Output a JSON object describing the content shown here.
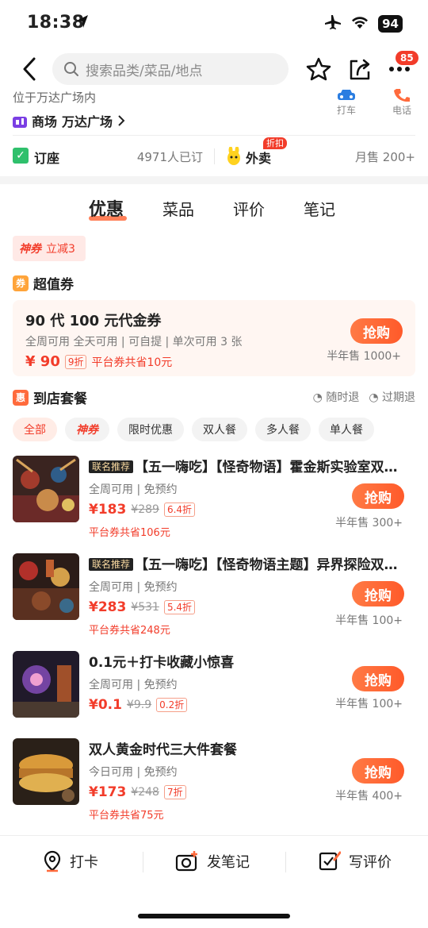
{
  "status": {
    "time": "18:38",
    "battery": "94"
  },
  "nav": {
    "search_placeholder": "搜索品类/菜品/地点",
    "more_badge": "85"
  },
  "shop": {
    "address": "位于万达广场内",
    "mall_label": "商场",
    "mall_name": "万达广场",
    "quick_car": "打车",
    "quick_phone": "电话"
  },
  "booking": {
    "label": "订座",
    "count": "4971人已订",
    "takeout_label": "外卖",
    "takeout_badge": "折扣",
    "monthly_sales": "月售 200+"
  },
  "tabs": [
    "优惠",
    "菜品",
    "评价",
    "笔记"
  ],
  "promo": {
    "logo": "神券",
    "text": "立减3"
  },
  "voucher_section": {
    "icon": "券",
    "title": "超值券",
    "voucher_title": "90 代 100 元代金券",
    "tags": "全周可用 全天可用 | 可自提 | 单次可用 3 张",
    "price": "¥ 90",
    "discount": "9折",
    "save": "平台券共省10元",
    "buy": "抢购",
    "sold": "半年售 1000+"
  },
  "deal_section": {
    "icon": "惠",
    "title": "到店套餐",
    "refund1": "随时退",
    "refund2": "过期退",
    "chips": [
      "全部",
      "神券",
      "限时优惠",
      "双人餐",
      "多人餐",
      "单人餐"
    ]
  },
  "deals": [
    {
      "tag": "联名推荐",
      "title": "【五一嗨吃】【怪奇物语】霍金斯实验室双人套餐",
      "sub": "全周可用 | 免预约",
      "price": "¥183",
      "orig": "¥289",
      "disc": "6.4折",
      "save": "平台券共省106元",
      "buy": "抢购",
      "sold": "半年售 300+"
    },
    {
      "tag": "联名推荐",
      "title": "【五一嗨吃】【怪奇物语主题】异界探险双人套餐",
      "sub": "全周可用 | 免预约",
      "price": "¥283",
      "orig": "¥531",
      "disc": "5.4折",
      "save": "平台券共省248元",
      "buy": "抢购",
      "sold": "半年售 100+"
    },
    {
      "tag": "",
      "title": "0.1元＋打卡收藏小惊喜",
      "sub": "全周可用 | 免预约",
      "price": "¥0.1",
      "orig": "¥9.9",
      "disc": "0.2折",
      "save": "",
      "buy": "抢购",
      "sold": "半年售 100+"
    },
    {
      "tag": "",
      "title": "双人黄金时代三大件套餐",
      "sub": "今日可用 | 免预约",
      "price": "¥173",
      "orig": "¥248",
      "disc": "7折",
      "save": "平台券共省75元",
      "buy": "抢购",
      "sold": "半年售 400+"
    }
  ],
  "bottom": {
    "checkin": "打卡",
    "note": "发笔记",
    "review": "写评价"
  }
}
